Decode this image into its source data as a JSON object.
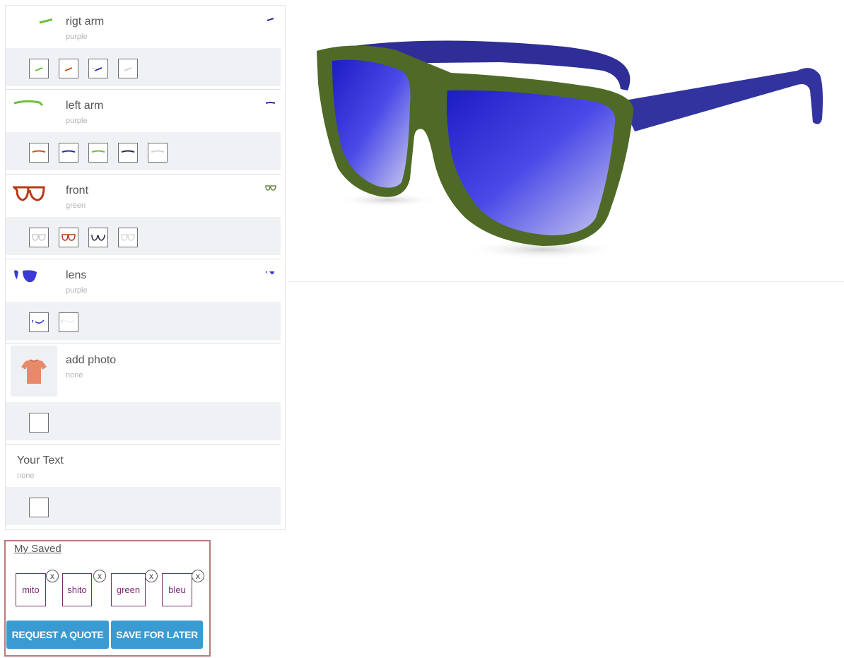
{
  "parts": [
    {
      "name": "rigt arm",
      "value": "purple",
      "thumb_icon": "right-arm-icon",
      "mini_icon": "right-arm-mini-icon"
    },
    {
      "name": "left arm",
      "value": "purple",
      "thumb_icon": "left-arm-icon",
      "mini_icon": "left-arm-mini-icon"
    },
    {
      "name": "front",
      "value": "green",
      "thumb_icon": "front-frame-icon",
      "mini_icon": "front-frame-mini-icon"
    },
    {
      "name": "lens",
      "value": "purple",
      "thumb_icon": "lens-icon",
      "mini_icon": "lens-mini-icon"
    },
    {
      "name": "add photo",
      "value": "none",
      "thumb_icon": "tshirt-photo-icon"
    },
    {
      "name": "Your Text",
      "value": "none"
    }
  ],
  "colors": {
    "accent_button": "#3a9ad2",
    "saved_border": "#b87b7e",
    "chip_color": "#7a2e72",
    "frame_green": "#4f6a26",
    "arm_purple": "#2d2d9a",
    "lens_blue": "#3a3ad6"
  },
  "saved": {
    "title": "My Saved",
    "items": [
      "mito",
      "shito",
      "green",
      "bleu"
    ],
    "remove_label": "x"
  },
  "buttons": {
    "quote": "REQUEST A QUOTE",
    "save": "SAVE FOR LATER"
  }
}
